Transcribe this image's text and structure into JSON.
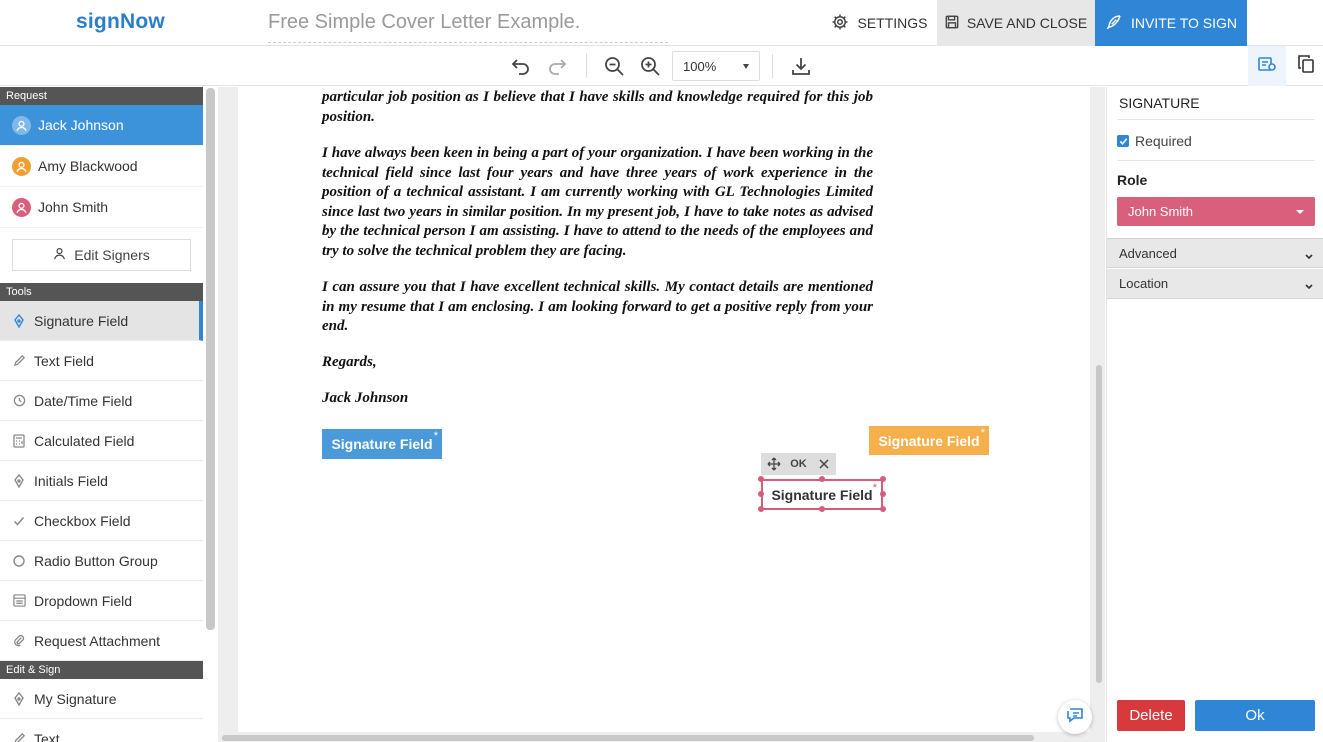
{
  "header": {
    "logo": "signNow",
    "document_title": "Free Simple Cover Letter Example.",
    "settings_label": "SETTINGS",
    "save_label": "SAVE AND CLOSE",
    "invite_label": "INVITE TO SIGN"
  },
  "toolbar": {
    "zoom_value": "100%",
    "icons": [
      "undo-icon",
      "redo-icon",
      "zoom-out-icon",
      "zoom-in-icon",
      "download-icon",
      "field-settings-icon",
      "copy-icon"
    ]
  },
  "sidebar": {
    "request_heading": "Request",
    "signers": [
      {
        "name": "Jack Johnson",
        "color": "#3d93d9"
      },
      {
        "name": "Amy Blackwood",
        "color": "#f0a033"
      },
      {
        "name": "John Smith",
        "color": "#d9607d"
      }
    ],
    "edit_signers_label": "Edit Signers",
    "tools_heading": "Tools",
    "tools": [
      {
        "label": "Signature Field",
        "icon": "pen-nib-icon"
      },
      {
        "label": "Text Field",
        "icon": "pencil-icon"
      },
      {
        "label": "Date/Time Field",
        "icon": "clock-icon"
      },
      {
        "label": "Calculated Field",
        "icon": "calculator-icon"
      },
      {
        "label": "Initials Field",
        "icon": "pen-nib-icon"
      },
      {
        "label": "Checkbox Field",
        "icon": "check-icon"
      },
      {
        "label": "Radio Button Group",
        "icon": "radio-icon"
      },
      {
        "label": "Dropdown Field",
        "icon": "dropdown-icon"
      },
      {
        "label": "Request Attachment",
        "icon": "paperclip-icon"
      }
    ],
    "edit_sign_heading": "Edit & Sign",
    "edit_sign_items": [
      {
        "label": "My Signature",
        "icon": "pen-nib-icon"
      },
      {
        "label": "Text",
        "icon": "pencil-icon"
      }
    ]
  },
  "document": {
    "paragraphs": [
      "particular job position as I believe that I have skills and knowledge required for this job position.",
      "I have always been keen in being a part of your organization. I have been working in the technical field since last four years and have three years of work experience in the position of a technical assistant. I am currently working with GL Technologies Limited since last two years in similar position. In my present job, I have to take notes as advised by the technical person I am assisting. I have to attend to the needs of the employees and try to solve the technical problem they are facing.",
      "I can assure you that I have excellent technical skills. My contact details are mentioned in my resume that I am enclosing. I am looking forward to get a positive reply from your end."
    ],
    "closing": "Regards,",
    "signer_name": "Jack Johnson",
    "fields": [
      {
        "label": "Signature Field",
        "required_mark": "*",
        "color": "#4a9ad9"
      },
      {
        "label": "Signature Field",
        "required_mark": "*",
        "color": "#f5b04c"
      },
      {
        "label": "Signature Field",
        "required_mark": "*",
        "color": "#d45d7c"
      }
    ],
    "ctrl_ok": "OK"
  },
  "right_panel": {
    "title": "SIGNATURE",
    "required_label": "Required",
    "required_checked": true,
    "role_label": "Role",
    "role_value": "John Smith",
    "advanced_label": "Advanced",
    "location_label": "Location",
    "delete_label": "Delete",
    "ok_label": "Ok"
  },
  "colors": {
    "accent": "#2f86d6",
    "role_pink": "#d9607d",
    "delete_red": "#d8393c"
  }
}
